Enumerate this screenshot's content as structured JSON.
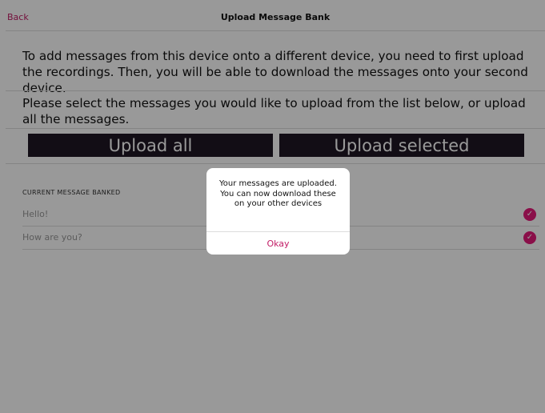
{
  "nav": {
    "back_label": "Back",
    "title": "Upload Message Bank"
  },
  "intro": {
    "paragraph1": "To add messages from this device onto a different device, you need to first upload the recordings. Then, you will be able to download the messages onto your second device.",
    "paragraph2": "Please select the messages you would like to upload from the list below, or upload all the messages."
  },
  "buttons": {
    "upload_all": "Upload all",
    "upload_selected": "Upload selected"
  },
  "list": {
    "header": "CURRENT MESSAGE BANKED",
    "items": [
      {
        "label": "Hello!",
        "checked": true,
        "check_icon": "check-circle-icon"
      },
      {
        "label": "How are you?",
        "checked": true,
        "check_icon": "check-circle-icon"
      }
    ]
  },
  "dialog": {
    "message": "Your messages are uploaded. You can now download these on your other devices",
    "ok_label": "Okay"
  },
  "colors": {
    "accent": "#c21d66",
    "check": "#e6197a",
    "button_bg": "#1f1624",
    "overlay": "rgba(0,0,0,0.40)"
  }
}
